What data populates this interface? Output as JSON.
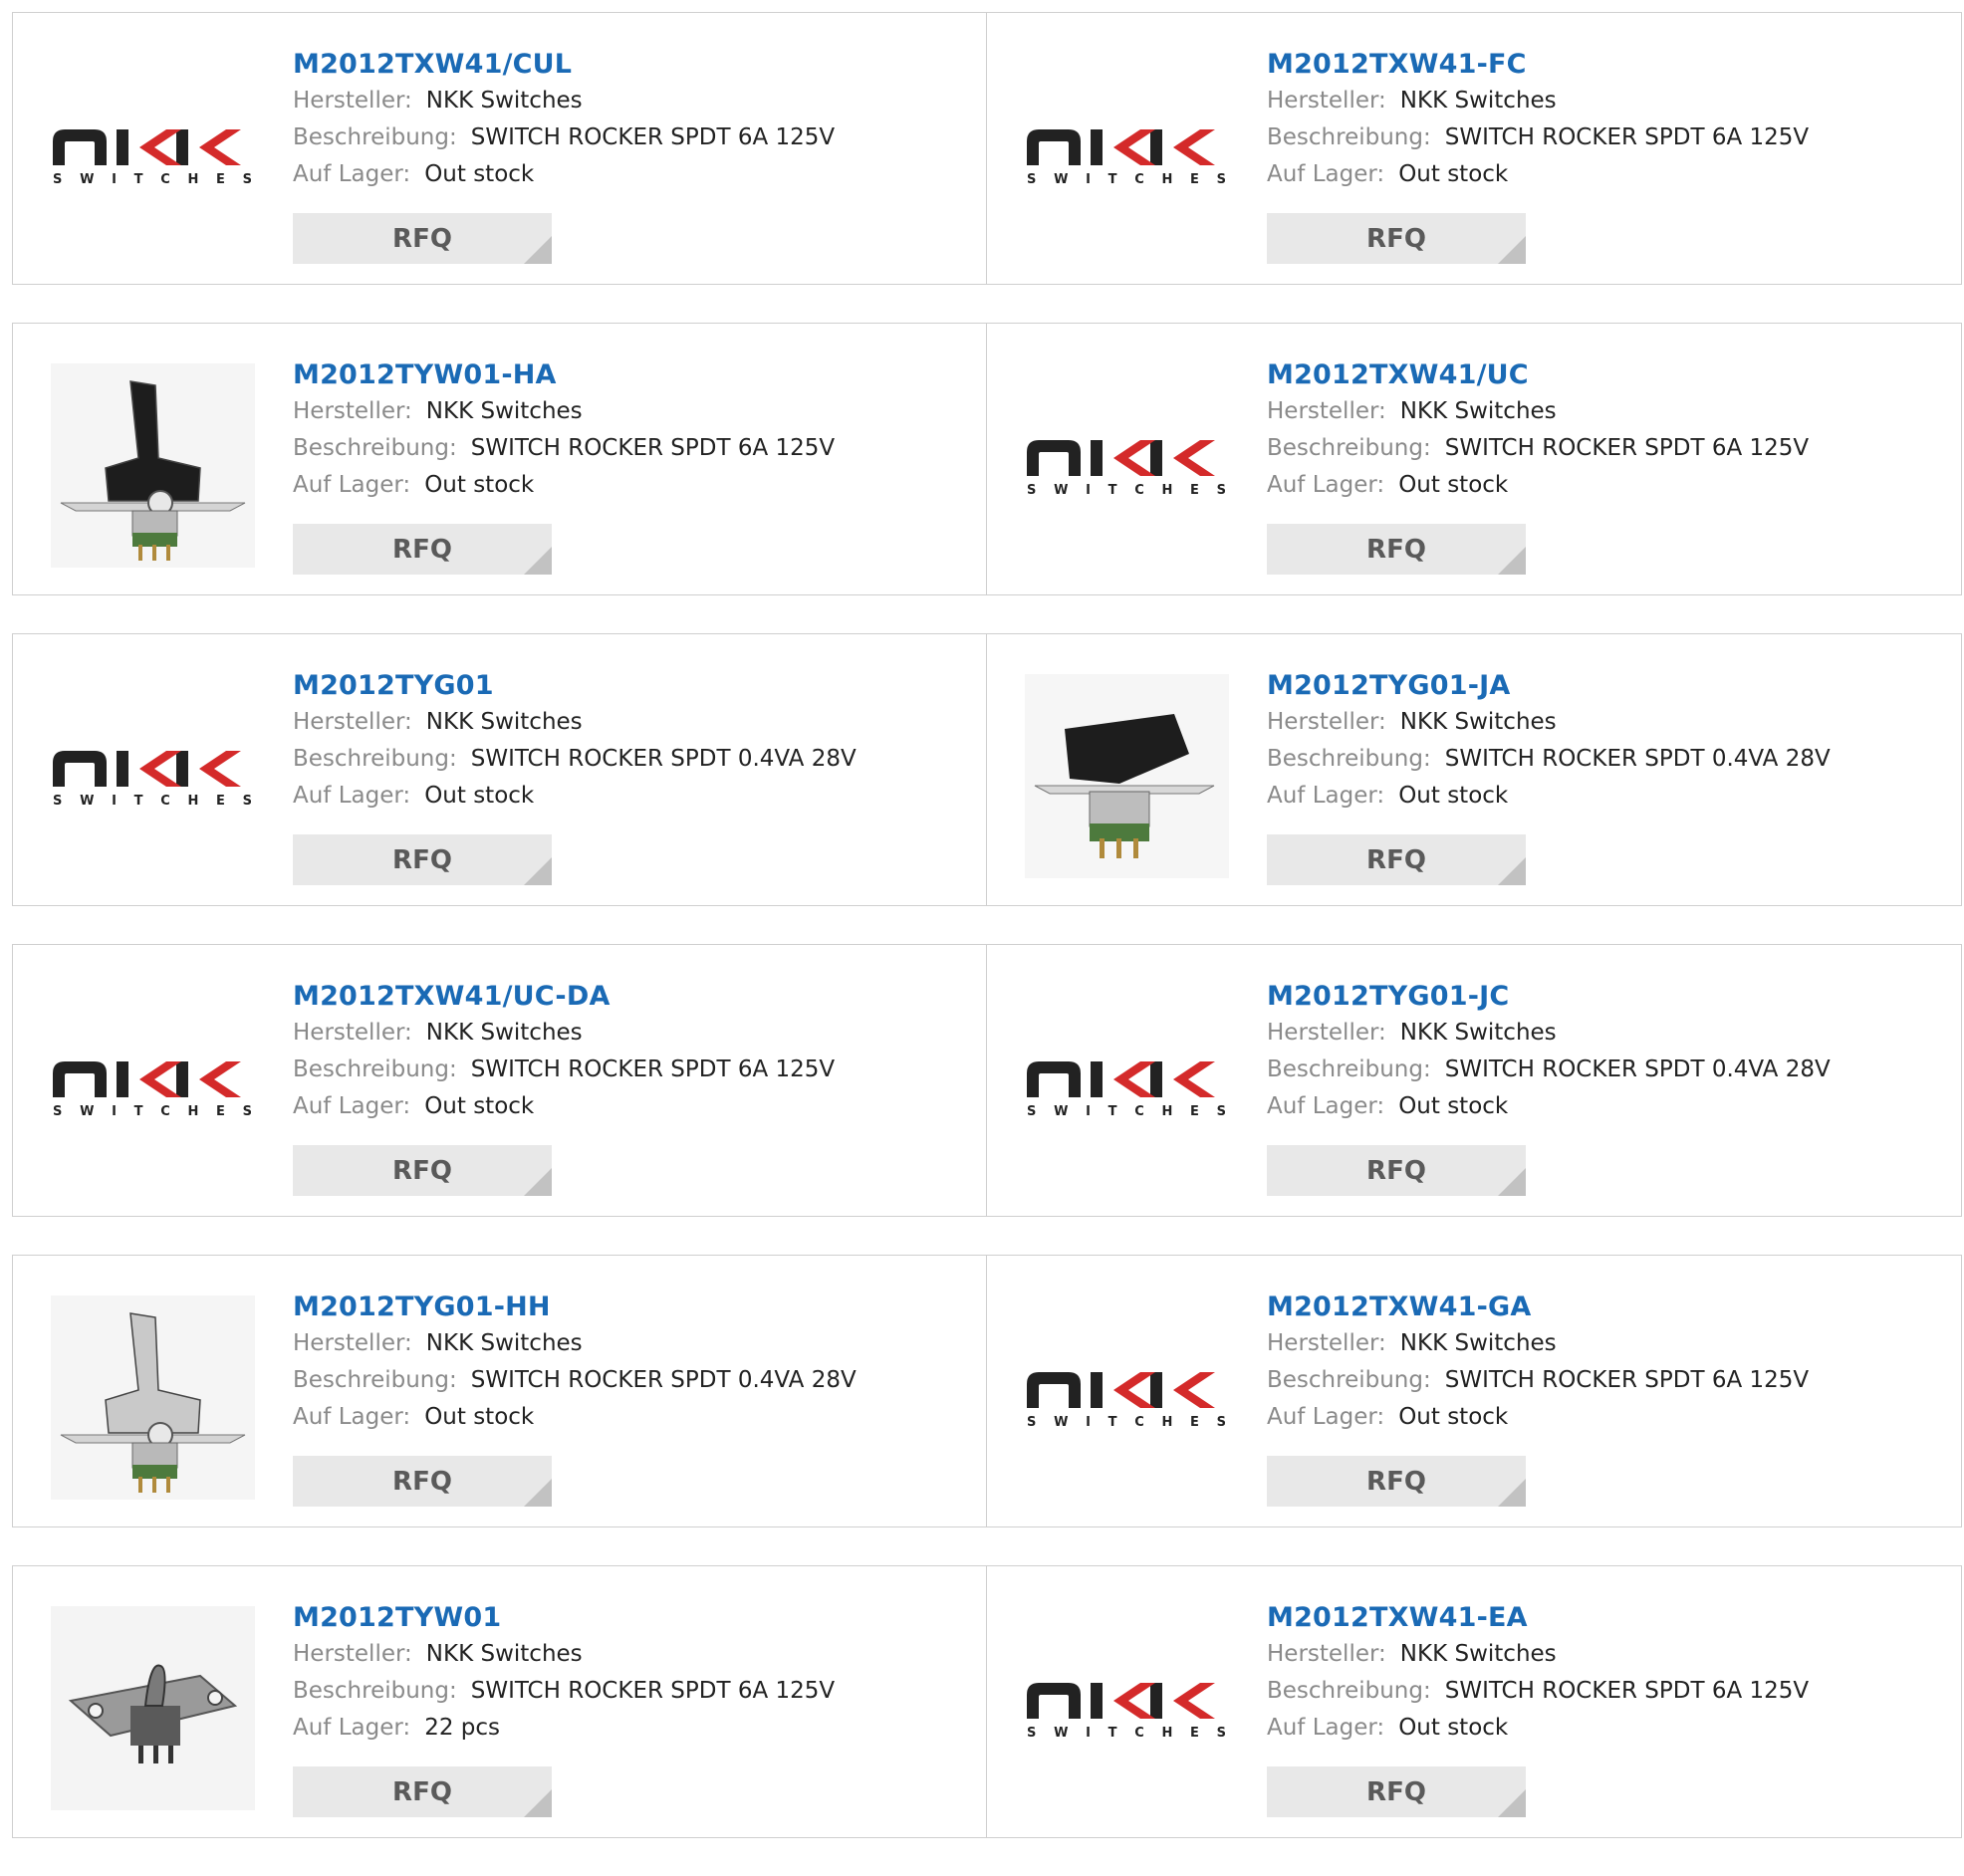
{
  "labels": {
    "manufacturer": "Hersteller:",
    "description": "Beschreibung:",
    "stock": "Auf Lager:",
    "rfq": "RFQ"
  },
  "colors": {
    "title": "#1a6ab5",
    "label": "#8a8a8a",
    "logo_red": "#d42a2a"
  },
  "products": [
    {
      "part": "M2012TXW41/CUL",
      "manufacturer": "NKK Switches",
      "description": "SWITCH ROCKER SPDT 6A 125V",
      "stock": "Out stock",
      "image": "nkk-logo"
    },
    {
      "part": "M2012TXW41-FC",
      "manufacturer": "NKK Switches",
      "description": "SWITCH ROCKER SPDT 6A 125V",
      "stock": "Out stock",
      "image": "nkk-logo"
    },
    {
      "part": "M2012TYW01-HA",
      "manufacturer": "NKK Switches",
      "description": "SWITCH ROCKER SPDT 6A 125V",
      "stock": "Out stock",
      "image": "switch-photo-black-tall"
    },
    {
      "part": "M2012TXW41/UC",
      "manufacturer": "NKK Switches",
      "description": "SWITCH ROCKER SPDT 6A 125V",
      "stock": "Out stock",
      "image": "nkk-logo"
    },
    {
      "part": "M2012TYG01",
      "manufacturer": "NKK Switches",
      "description": "SWITCH ROCKER SPDT 0.4VA 28V",
      "stock": "Out stock",
      "image": "nkk-logo"
    },
    {
      "part": "M2012TYG01-JA",
      "manufacturer": "NKK Switches",
      "description": "SWITCH ROCKER SPDT 0.4VA 28V",
      "stock": "Out stock",
      "image": "switch-photo-black-rocker"
    },
    {
      "part": "M2012TXW41/UC-DA",
      "manufacturer": "NKK Switches",
      "description": "SWITCH ROCKER SPDT 6A 125V",
      "stock": "Out stock",
      "image": "nkk-logo"
    },
    {
      "part": "M2012TYG01-JC",
      "manufacturer": "NKK Switches",
      "description": "SWITCH ROCKER SPDT 0.4VA 28V",
      "stock": "Out stock",
      "image": "nkk-logo"
    },
    {
      "part": "M2012TYG01-HH",
      "manufacturer": "NKK Switches",
      "description": "SWITCH ROCKER SPDT 0.4VA 28V",
      "stock": "Out stock",
      "image": "switch-photo-grey-tall"
    },
    {
      "part": "M2012TXW41-GA",
      "manufacturer": "NKK Switches",
      "description": "SWITCH ROCKER SPDT 6A 125V",
      "stock": "Out stock",
      "image": "nkk-logo"
    },
    {
      "part": "M2012TYW01",
      "manufacturer": "NKK Switches",
      "description": "SWITCH ROCKER SPDT 6A 125V",
      "stock": "22 pcs",
      "image": "switch-photo-base"
    },
    {
      "part": "M2012TXW41-EA",
      "manufacturer": "NKK Switches",
      "description": "SWITCH ROCKER SPDT 6A 125V",
      "stock": "Out stock",
      "image": "nkk-logo"
    }
  ],
  "logo_text": {
    "brand": "NKK",
    "sub": "SWITCHES"
  }
}
